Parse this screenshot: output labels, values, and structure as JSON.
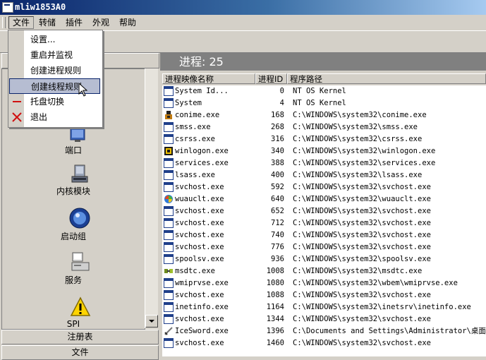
{
  "window": {
    "title": "mliw1853A0"
  },
  "menubar": {
    "items": [
      {
        "label": "文件"
      },
      {
        "label": "转储"
      },
      {
        "label": "插件"
      },
      {
        "label": "外观"
      },
      {
        "label": "帮助"
      }
    ]
  },
  "file_menu": {
    "items": [
      {
        "label": "设置...",
        "icon": ""
      },
      {
        "label": "重启并监视",
        "icon": ""
      },
      {
        "label": "创建进程规则",
        "icon": ""
      },
      {
        "label": "创建线程规则",
        "icon": "",
        "highlighted": true
      },
      {
        "label": "托盘切换",
        "icon": "minus-icon"
      },
      {
        "label": "退出",
        "icon": "close-icon"
      }
    ]
  },
  "left_nav": {
    "items": [
      {
        "label": "端口",
        "icon": "port-icon"
      },
      {
        "label": "内核模块",
        "icon": "kernel-module-icon"
      },
      {
        "label": "启动组",
        "icon": "startup-group-icon"
      },
      {
        "label": "服务",
        "icon": "service-icon"
      },
      {
        "label": "SPI",
        "icon": "spi-warning-icon"
      }
    ],
    "sections": [
      {
        "label": "注册表"
      },
      {
        "label": "文件"
      }
    ]
  },
  "process_panel": {
    "header": "进程: 25",
    "columns": [
      "进程映像名称",
      "进程ID",
      "程序路径"
    ],
    "rows": [
      {
        "name": "System Id...",
        "pid": "0",
        "path": "NT OS Kernel",
        "icon": "window-icon"
      },
      {
        "name": "System",
        "pid": "4",
        "path": "NT OS Kernel",
        "icon": "window-icon"
      },
      {
        "name": "conime.exe",
        "pid": "168",
        "path": "C:\\WINDOWS\\system32\\conime.exe",
        "icon": "conime-icon"
      },
      {
        "name": "smss.exe",
        "pid": "268",
        "path": "C:\\WINDOWS\\system32\\smss.exe",
        "icon": "window-icon"
      },
      {
        "name": "csrss.exe",
        "pid": "316",
        "path": "C:\\WINDOWS\\system32\\csrss.exe",
        "icon": "window-icon"
      },
      {
        "name": "winlogon.exe",
        "pid": "340",
        "path": "C:\\WINDOWS\\system32\\winlogon.exe",
        "icon": "winlogon-icon"
      },
      {
        "name": "services.exe",
        "pid": "388",
        "path": "C:\\WINDOWS\\system32\\services.exe",
        "icon": "window-icon"
      },
      {
        "name": "lsass.exe",
        "pid": "400",
        "path": "C:\\WINDOWS\\system32\\lsass.exe",
        "icon": "window-icon"
      },
      {
        "name": "svchost.exe",
        "pid": "592",
        "path": "C:\\WINDOWS\\system32\\svchost.exe",
        "icon": "window-icon"
      },
      {
        "name": "wuauclt.exe",
        "pid": "640",
        "path": "C:\\WINDOWS\\system32\\wuauclt.exe",
        "icon": "wuauclt-icon"
      },
      {
        "name": "svchost.exe",
        "pid": "652",
        "path": "C:\\WINDOWS\\system32\\svchost.exe",
        "icon": "window-icon"
      },
      {
        "name": "svchost.exe",
        "pid": "712",
        "path": "C:\\WINDOWS\\system32\\svchost.exe",
        "icon": "window-icon"
      },
      {
        "name": "svchost.exe",
        "pid": "740",
        "path": "C:\\WINDOWS\\system32\\svchost.exe",
        "icon": "window-icon"
      },
      {
        "name": "svchost.exe",
        "pid": "776",
        "path": "C:\\WINDOWS\\system32\\svchost.exe",
        "icon": "window-icon"
      },
      {
        "name": "spoolsv.exe",
        "pid": "936",
        "path": "C:\\WINDOWS\\system32\\spoolsv.exe",
        "icon": "window-icon"
      },
      {
        "name": "msdtc.exe",
        "pid": "1008",
        "path": "C:\\WINDOWS\\system32\\msdtc.exe",
        "icon": "msdtc-icon"
      },
      {
        "name": "wmiprvse.exe",
        "pid": "1080",
        "path": "C:\\WINDOWS\\system32\\wbem\\wmiprvse.exe",
        "icon": "window-icon"
      },
      {
        "name": "svchost.exe",
        "pid": "1088",
        "path": "C:\\WINDOWS\\system32\\svchost.exe",
        "icon": "window-icon"
      },
      {
        "name": "inetinfo.exe",
        "pid": "1164",
        "path": "C:\\WINDOWS\\system32\\inetsrv\\inetinfo.exe",
        "icon": "window-icon"
      },
      {
        "name": "svchost.exe",
        "pid": "1344",
        "path": "C:\\WINDOWS\\system32\\svchost.exe",
        "icon": "window-icon"
      },
      {
        "name": "IceSword.exe",
        "pid": "1396",
        "path": "C:\\Documents and Settings\\Administrator\\桌面\\I",
        "icon": "icesword-icon"
      },
      {
        "name": "svchost.exe",
        "pid": "1460",
        "path": "C:\\WINDOWS\\system32\\svchost.exe",
        "icon": "window-icon"
      }
    ]
  }
}
